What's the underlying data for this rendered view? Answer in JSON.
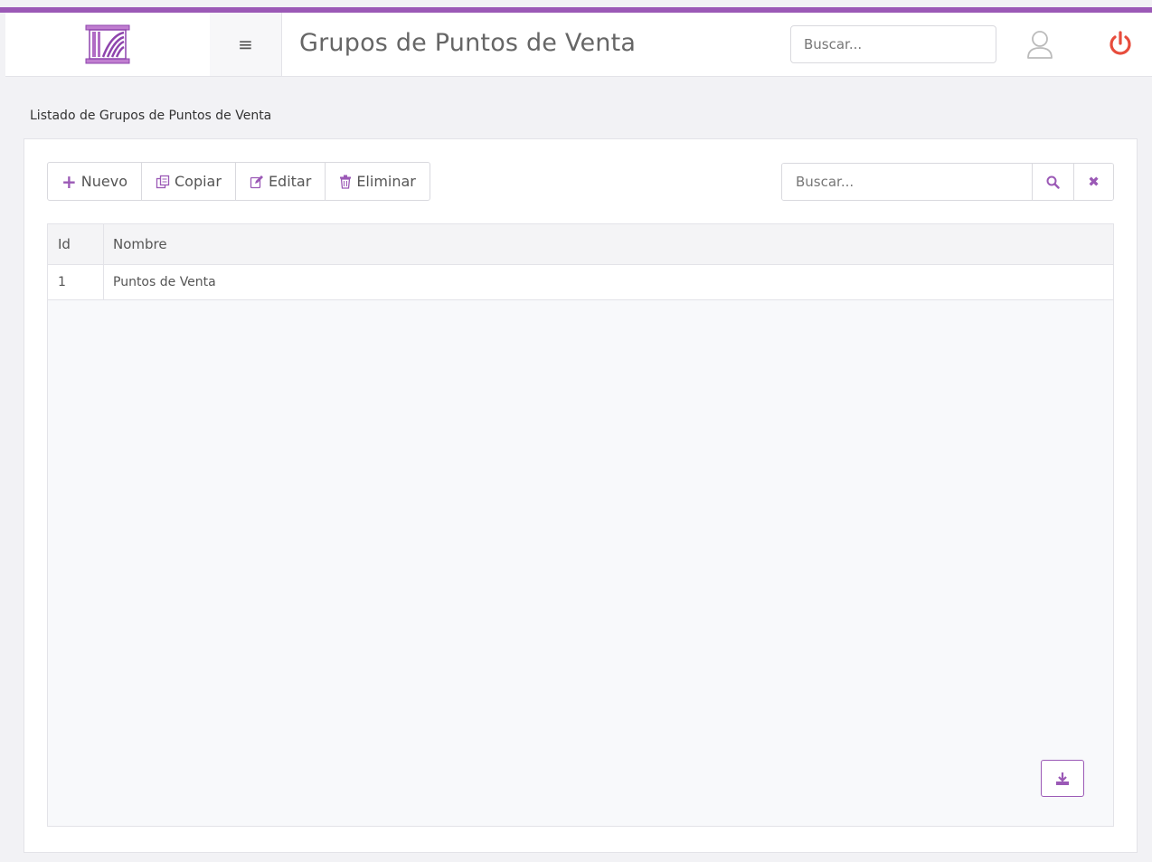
{
  "header": {
    "title": "Grupos de Puntos de Venta",
    "search_placeholder": "Buscar...",
    "menu_icon": "hamburger-icon",
    "user_icon": "user-icon",
    "power_icon": "power-icon",
    "logo_icon": "company-logo"
  },
  "breadcrumb": "Listado de Grupos de Puntos de Venta",
  "toolbar": {
    "new_label": "Nuevo",
    "copy_label": "Copiar",
    "edit_label": "Editar",
    "delete_label": "Eliminar"
  },
  "search": {
    "placeholder": "Buscar...",
    "search_icon": "search-icon",
    "clear_icon": "close-icon"
  },
  "grid": {
    "columns": [
      "Id",
      "Nombre"
    ],
    "rows": [
      {
        "id": "1",
        "nombre": "Puntos de Venta"
      }
    ]
  },
  "export": {
    "icon": "download-icon"
  },
  "colors": {
    "accent": "#9b59b6",
    "power": "#e74c3c",
    "background": "#f2f2f5"
  }
}
